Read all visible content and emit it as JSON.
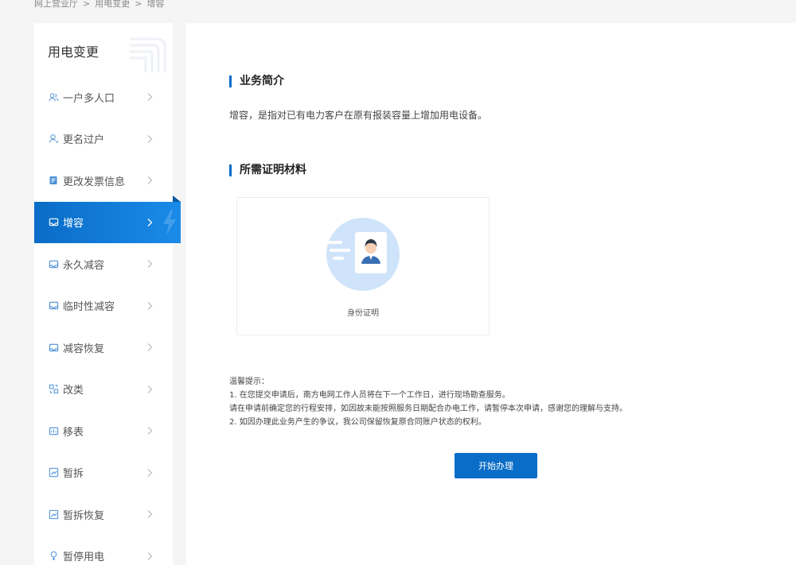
{
  "breadcrumb": {
    "items": [
      "网上营业厅",
      "用电变更",
      "增容"
    ],
    "separator": ">"
  },
  "sidebar": {
    "title": "用电变更",
    "items": [
      {
        "label": "一户多人口",
        "icon": "users-icon"
      },
      {
        "label": "更名过户",
        "icon": "user-icon"
      },
      {
        "label": "更改发票信息",
        "icon": "invoice-icon"
      },
      {
        "label": "增容",
        "icon": "capacity-icon",
        "active": true
      },
      {
        "label": "永久减容",
        "icon": "capacity-icon"
      },
      {
        "label": "临时性减容",
        "icon": "capacity-icon"
      },
      {
        "label": "减容恢复",
        "icon": "capacity-icon"
      },
      {
        "label": "改类",
        "icon": "change-type-icon"
      },
      {
        "label": "移表",
        "icon": "meter-move-icon"
      },
      {
        "label": "暂拆",
        "icon": "chart-icon"
      },
      {
        "label": "暂拆恢复",
        "icon": "chart-icon"
      },
      {
        "label": "暂停用电",
        "icon": "pause-icon"
      }
    ]
  },
  "main": {
    "intro_title": "业务简介",
    "intro_text": "增容，是指对已有电力客户在原有报装容量上增加用电设备。",
    "materials_title": "所需证明材料",
    "materials": [
      {
        "label": "身份证明"
      }
    ],
    "tips_title": "温馨提示：",
    "tips": [
      "1. 在您提交申请后，南方电网工作人员将在下一个工作日，进行现场勘查服务。",
      "请在申请前确定您的行程安排，如因故未能按照服务日期配合办电工作，请暂停本次申请，感谢您的理解与支持。",
      "2. 如因办理此业务产生的争议，我公司保留恢复原合同账户状态的权利。"
    ],
    "start_button": "开始办理"
  },
  "colors": {
    "accent": "#0a6dc7",
    "background": "#f5f5f5"
  }
}
